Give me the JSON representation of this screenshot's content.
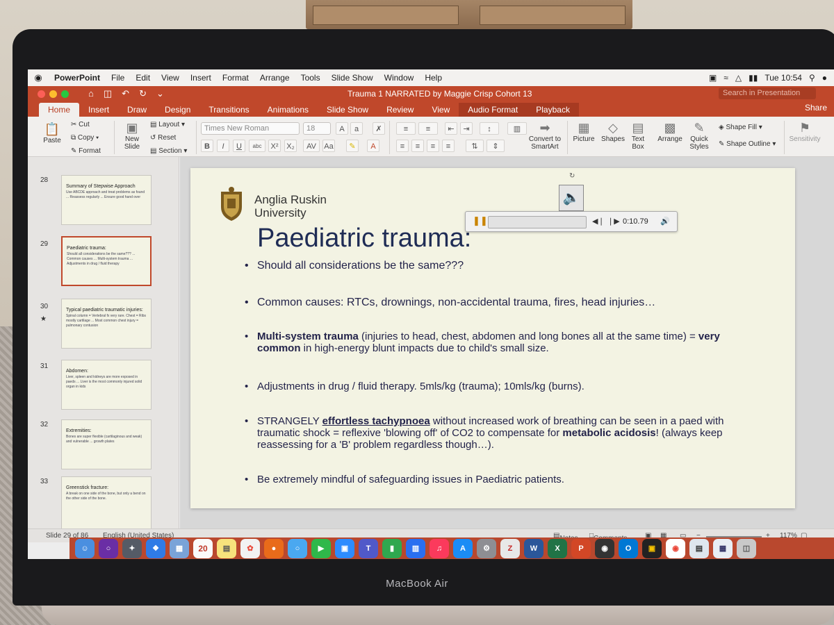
{
  "menubar": {
    "app": "PowerPoint",
    "items": [
      "File",
      "Edit",
      "View",
      "Insert",
      "Format",
      "Arrange",
      "Tools",
      "Slide Show",
      "Window",
      "Help"
    ],
    "clock": "Tue 10:54"
  },
  "window": {
    "title": "Trauma 1 NARRATED by Maggie Crisp Cohort 13",
    "search_placeholder": "Search in Presentation",
    "share": "Share"
  },
  "tabs": [
    "Home",
    "Insert",
    "Draw",
    "Design",
    "Transitions",
    "Animations",
    "Slide Show",
    "Review",
    "View",
    "Audio Format",
    "Playback"
  ],
  "ribbon": {
    "paste": "Paste",
    "cut": "Cut",
    "copy": "Copy",
    "format": "Format",
    "new_slide": "New Slide",
    "layout": "Layout",
    "reset": "Reset",
    "section": "Section",
    "font": "Times New Roman",
    "font_size": "18",
    "convert_smartart": "Convert to SmartArt",
    "picture": "Picture",
    "shapes": "Shapes",
    "text_box": "Text Box",
    "arrange": "Arrange",
    "quick_styles": "Quick Styles",
    "shape_fill": "Shape Fill",
    "shape_outline": "Shape Outline",
    "sensitivity": "Sensitivity"
  },
  "thumbnails": [
    {
      "num": "28",
      "title": "Summary of Stepwise Approach",
      "body": "Use ABCDE approach and treat problems as found ... Reassess regularly ... Ensure good hand over"
    },
    {
      "num": "29",
      "title": "Paediatric trauma:",
      "body": "Should all considerations be the same??? ... Common causes ... Multi-system trauma ... Adjustments in drug / fluid therapy"
    },
    {
      "num": "30",
      "title": "Typical paediatric traumatic injuries:",
      "body": "Spinal column = Vertebral fx very rare. Chest = Ribs mostly cartilage ... Most common chest injury = pulmonary contusion"
    },
    {
      "num": "31",
      "title": "Abdomen:",
      "body": "Liver, spleen and kidneys are more exposed in paeds ... Liver is the most commonly injured solid organ in kids"
    },
    {
      "num": "32",
      "title": "Extremities:",
      "body": "Bones are super flexible (cartilaginous and weak) and vulnerable ... growth plates"
    },
    {
      "num": "33",
      "title": "Greenstick fracture:",
      "body": "A break on one side of the bone, but only a bend on the other side of the bone."
    }
  ],
  "slide": {
    "university_line1": "Anglia Ruskin",
    "university_line2": "University",
    "title": "Paediatric trauma:",
    "b1": "Should all considerations be the same???",
    "b2": "Common causes: RTCs, drownings, non-accidental trauma, fires, head injuries…",
    "b3_bold": "Multi-system trauma",
    "b3_a": " (injuries to head, chest, abdomen and long bones all at the same time) = ",
    "b3_bold2": " very common",
    "b3_b": " in high-energy blunt impacts due to child's small size.",
    "b4": "Adjustments in drug / fluid therapy. 5mls/kg (trauma); 10mls/kg (burns).",
    "b5_a": "STRANGELY ",
    "b5_bold": "effortless tachypnoea",
    "b5_b": " without increased work of breathing can be seen in a paed with traumatic shock = reflexive 'blowing off' of CO2 to compensate for ",
    "b5_bold2": "metabolic acidosis",
    "b5_c": "! (always keep reassessing for a 'B' problem regardless though…).",
    "b6": "Be extremely mindful of safeguarding issues in Paediatric patients."
  },
  "audio": {
    "time": "0:10.79"
  },
  "status": {
    "slide": "Slide 29 of 86",
    "language": "English (United States)",
    "notes": "Notes",
    "comments": "Comments",
    "zoom": "117%"
  },
  "dock_apps": [
    "Finder",
    "Siri",
    "Launchpad",
    "Safari",
    "Photos",
    "Calendar",
    "Notes",
    "Photos",
    "Firefox",
    "Messages",
    "FaceTime",
    "Zoom",
    "Teams",
    "Numbers",
    "Keynote",
    "Music",
    "App Store",
    "Preferences",
    "Zotero",
    "Word",
    "Excel",
    "PowerPoint",
    "Photo Booth",
    "Outlook",
    "Preview",
    "Chrome",
    "Finder",
    "Preview",
    "Trash"
  ],
  "device": {
    "brand": "MacBook Air"
  },
  "colors": {
    "office_accent": "#c0482b",
    "slide_title": "#1f2c55",
    "slide_bg": "#f3f3e3"
  }
}
